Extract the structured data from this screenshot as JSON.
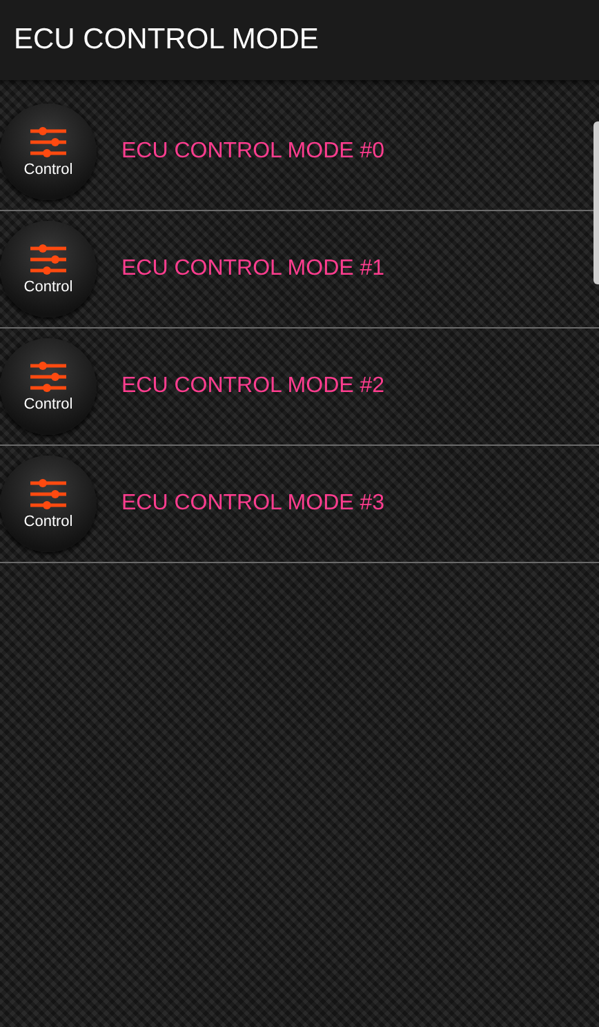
{
  "app_bar": {
    "title": "ECU CONTROL MODE"
  },
  "items": [
    {
      "icon_label": "Control",
      "title": "ECU CONTROL MODE #0"
    },
    {
      "icon_label": "Control",
      "title": "ECU CONTROL MODE #1"
    },
    {
      "icon_label": "Control",
      "title": "ECU CONTROL MODE #2"
    },
    {
      "icon_label": "Control",
      "title": "ECU CONTROL MODE #3"
    }
  ]
}
